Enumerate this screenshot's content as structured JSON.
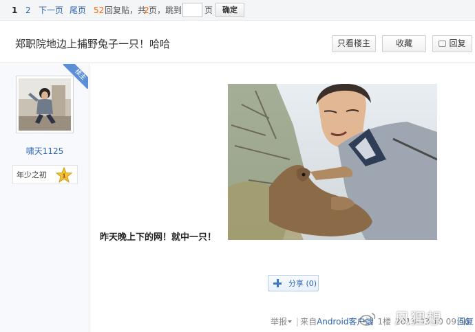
{
  "pager": {
    "current": "1",
    "page2": "2",
    "next": "下一页",
    "last": "尾页",
    "reply_count": "52",
    "reply_text": "回复贴，共",
    "page_total": "2",
    "page_text": "页，跳到",
    "page_unit": "页",
    "jump_input_value": "",
    "confirm": "确定"
  },
  "thread": {
    "title": "郑职院地边上捕野兔子一只！哈哈",
    "only_op": "只看楼主",
    "favorite": "收藏",
    "reply": "回复"
  },
  "author": {
    "badge": "楼主",
    "name": "啸天1125",
    "level_name": "年少之初",
    "level_num": "1"
  },
  "post": {
    "text": "昨天晚上下的网！就中一只！",
    "photo_icon": "photo-man-holding-rabbit"
  },
  "share": {
    "label": "分享",
    "count": "(0)"
  },
  "footer": {
    "report": "举报",
    "from_text": "来自",
    "source": "Android客户端",
    "floor": "1楼",
    "datetime": "2013-03-10 09:56",
    "reply": "回复",
    "watermark": "风狸想"
  },
  "colors": {
    "link": "#2d64b3",
    "accent_orange": "#ff6600",
    "badge_blue": "#5b8fd6"
  }
}
